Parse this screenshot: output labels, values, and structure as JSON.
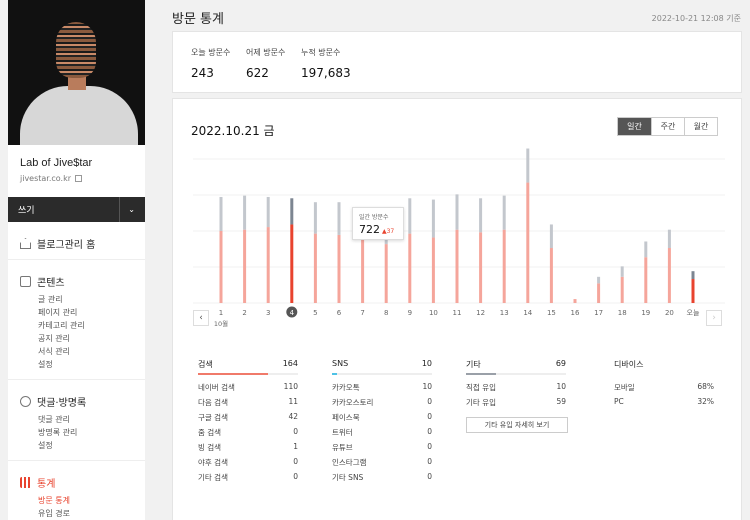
{
  "sidebar": {
    "blog_name": "Lab of Jive$tar",
    "blog_url": "jivestar.co.kr",
    "write_label": "쓰기",
    "menu_home": "블로그관리 홈",
    "sections": [
      {
        "title": "콘텐츠",
        "items": [
          "글 관리",
          "페이지 관리",
          "카테고리 관리",
          "공지 관리",
          "서식 관리",
          "설정"
        ]
      },
      {
        "title": "댓글·방명록",
        "items": [
          "댓글 관리",
          "방명록 관리",
          "설정"
        ]
      },
      {
        "title": "통계",
        "items": [
          "방문 통계",
          "유입 경로"
        ]
      }
    ]
  },
  "header": {
    "title": "방문 통계",
    "timestamp": "2022-10-21 12:08 기준"
  },
  "summary": {
    "today_label": "오늘 방문수",
    "today_value": "243",
    "yesterday_label": "어제 방문수",
    "yesterday_value": "622",
    "total_label": "누적 방문수",
    "total_value": "197,683"
  },
  "main": {
    "date_title": "2022.10.21 금",
    "tabs": [
      "일간",
      "주간",
      "월간"
    ],
    "month_label": "10월",
    "prev_icon": "chevron-left-icon",
    "next_icon": "chevron-right-icon"
  },
  "tooltip": {
    "label": "일간 방문수",
    "value": "722",
    "delta": "▲37"
  },
  "chart_data": {
    "type": "bar",
    "categories": [
      "1",
      "2",
      "3",
      "4",
      "5",
      "6",
      "7",
      "8",
      "9",
      "10",
      "11",
      "12",
      "13",
      "14",
      "15",
      "16",
      "17",
      "18",
      "19",
      "20",
      "오늘"
    ],
    "series": [
      {
        "values": [
          550,
          560,
          580,
          600,
          530,
          520,
          500,
          450,
          530,
          500,
          560,
          540,
          560,
          920,
          420,
          30,
          150,
          200,
          350,
          420,
          183
        ]
      },
      {
        "values": [
          260,
          260,
          230,
          200,
          240,
          250,
          222,
          200,
          270,
          290,
          270,
          260,
          260,
          260,
          180,
          0,
          50,
          80,
          120,
          140,
          60
        ]
      }
    ],
    "selected_index": 3,
    "ylim": [
      0,
      1100
    ],
    "grid": true,
    "colors": {
      "base": "#f5a59b",
      "top": "#c3c7cd",
      "selected": "#e8432e",
      "selected_top": "#7c8591"
    }
  },
  "referrals": [
    {
      "name": "검색",
      "total": "164",
      "color": "#f07a6a",
      "ratio": 1.0,
      "rows": [
        [
          "네이버 검색",
          "110"
        ],
        [
          "다음 검색",
          "11"
        ],
        [
          "구글 검색",
          "42"
        ],
        [
          "줌 검색",
          "0"
        ],
        [
          "빙 검색",
          "1"
        ],
        [
          "야후 검색",
          "0"
        ],
        [
          "기타 검색",
          "0"
        ]
      ]
    },
    {
      "name": "SNS",
      "total": "10",
      "color": "#4ec2e6",
      "ratio": 0.06,
      "rows": [
        [
          "카카오톡",
          "10"
        ],
        [
          "카카오스토리",
          "0"
        ],
        [
          "페이스북",
          "0"
        ],
        [
          "트위터",
          "0"
        ],
        [
          "유튜브",
          "0"
        ],
        [
          "인스타그램",
          "0"
        ],
        [
          "기타 SNS",
          "0"
        ]
      ]
    },
    {
      "name": "기타",
      "total": "69",
      "color": "#9aa0a8",
      "ratio": 0.42,
      "rows": [
        [
          "직접 유입",
          "10"
        ],
        [
          "기타 유입",
          "59"
        ]
      ],
      "button": "기타 유입 자세히 보기"
    },
    {
      "name": "디바이스",
      "total": "",
      "color": "#ffffff",
      "ratio": 0,
      "rows": [
        [
          "모바일",
          "68%"
        ],
        [
          "PC",
          "32%"
        ]
      ]
    }
  ]
}
